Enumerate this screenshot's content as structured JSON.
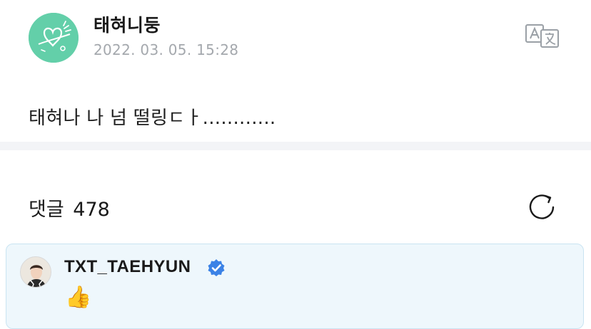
{
  "post": {
    "author": "태혀니둥",
    "date": "2022. 03. 05. 15:28",
    "body": "태혀나 나 넘 떨링ㄷㅏ............"
  },
  "comments": {
    "label": "댓글",
    "count": "478"
  },
  "top_comment": {
    "author": "TXT_TAEHYUN",
    "text": "👍"
  },
  "icons": {
    "translate": "translate-icon",
    "refresh": "refresh-icon",
    "verified": "verified-badge-icon"
  },
  "colors": {
    "avatar_bg": "#63cfa9",
    "date_text": "#a4a8ad",
    "comment_bg": "#eef7fc",
    "comment_border": "#c9e4f2",
    "verified": "#3b82e6"
  }
}
